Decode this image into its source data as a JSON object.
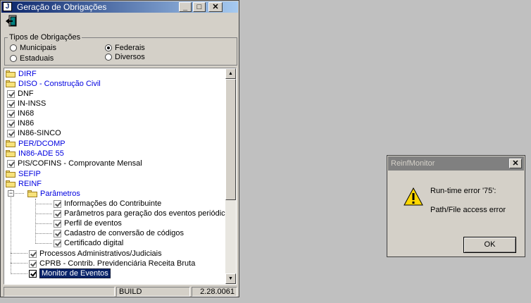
{
  "window": {
    "title": "Geração de Obrigações",
    "app_icon_glyph": "J"
  },
  "obligation_types": {
    "legend": "Tipos de Obrigações",
    "options": [
      {
        "label": "Municipais",
        "selected": false
      },
      {
        "label": "Estaduais",
        "selected": false
      },
      {
        "label": "Federais",
        "selected": true
      },
      {
        "label": "Diversos",
        "selected": false
      }
    ]
  },
  "tree": {
    "items": [
      {
        "label": "DIRF",
        "kind": "folder",
        "color": "#0000e0"
      },
      {
        "label": "DISO - Construção Civil",
        "kind": "folder",
        "color": "#0000e0"
      },
      {
        "label": "DNF",
        "kind": "check"
      },
      {
        "label": "IN-INSS",
        "kind": "check"
      },
      {
        "label": "IN68",
        "kind": "check"
      },
      {
        "label": "IN86",
        "kind": "check"
      },
      {
        "label": "IN86-SINCO",
        "kind": "check"
      },
      {
        "label": "PER/DCOMP",
        "kind": "folder",
        "color": "#0000e0"
      },
      {
        "label": "IN86-ADE 55",
        "kind": "folder",
        "color": "#0000e0"
      },
      {
        "label": "PIS/COFINS - Comprovante Mensal",
        "kind": "check"
      },
      {
        "label": "SEFIP",
        "kind": "folder",
        "color": "#0000e0"
      },
      {
        "label": "REINF",
        "kind": "folder",
        "color": "#0000e0"
      }
    ],
    "reinf_children": {
      "group_label": "Parâmetros",
      "group_items": [
        "Informações do Contribuinte",
        "Parâmetros para geração dos eventos periódicos",
        "Perfil de eventos",
        "Cadastro de conversão de códigos",
        "Certificado digital"
      ],
      "items": [
        "Processos Administrativos/Judiciais",
        "CPRB - Contrib. Previdenciária Receita Bruta",
        "Monitor de Eventos"
      ]
    }
  },
  "status_bar": {
    "panel2": "BUILD",
    "version": "2.28.0061"
  },
  "dialog": {
    "title": "ReinfMonitor",
    "message_line1": "Run-time error '75':",
    "message_line2": "Path/File access error",
    "ok_label": "OK"
  }
}
